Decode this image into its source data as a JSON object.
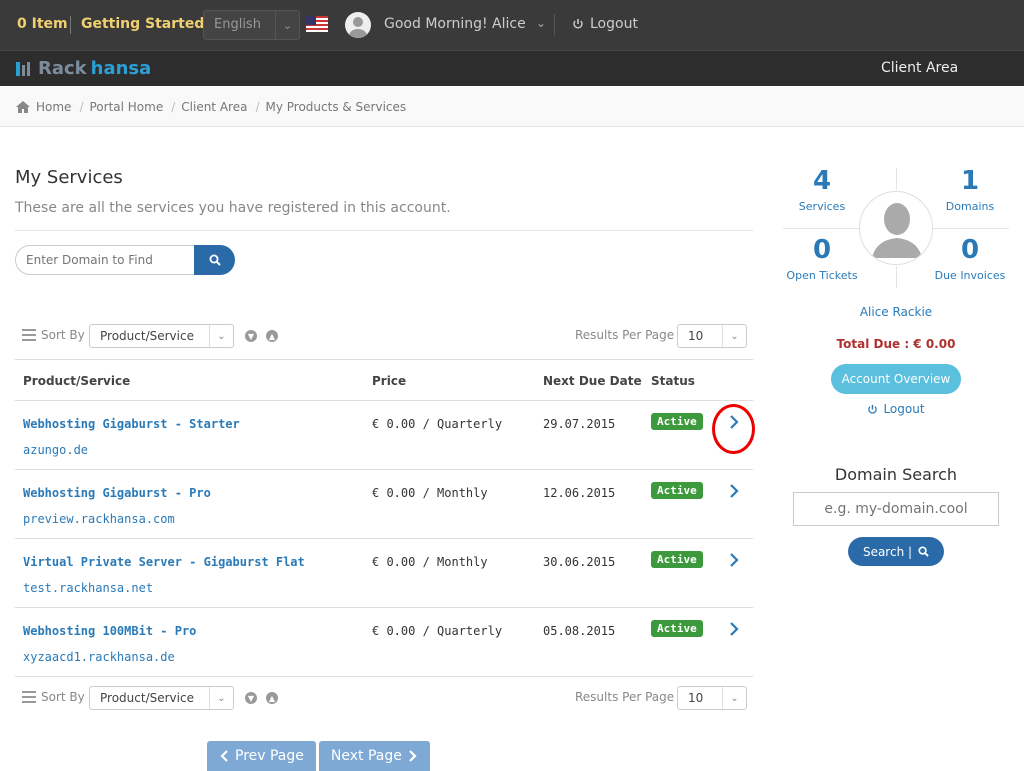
{
  "topbar": {
    "cart_items": "0 Item",
    "getting_started": "Getting Started",
    "language": "English",
    "greeting": "Good Morning! Alice",
    "logout": "Logout"
  },
  "brand": {
    "name_part1": "Rack",
    "name_part2": "hansa",
    "nav_client_area": "Client Area"
  },
  "breadcrumb": [
    "Home",
    "Portal Home",
    "Client Area",
    "My Products & Services"
  ],
  "main": {
    "title": "My Services",
    "subtitle": "These are all the services you have registered in this account.",
    "search_placeholder": "Enter Domain to Find",
    "sort_label": "Sort By",
    "sort_value": "Product/Service",
    "rpp_label": "Results Per Page",
    "rpp_value": "10",
    "columns": [
      "Product/Service",
      "Price",
      "Next Due Date",
      "Status"
    ],
    "rows": [
      {
        "name": "Webhosting Gigaburst - Starter",
        "domain": "azungo.de",
        "price": "€ 0.00 / Quarterly",
        "due": "29.07.2015",
        "status": "Active"
      },
      {
        "name": "Webhosting Gigaburst - Pro",
        "domain": "preview.rackhansa.com",
        "price": "€ 0.00 / Monthly",
        "due": "12.06.2015",
        "status": "Active"
      },
      {
        "name": "Virtual Private Server - Gigaburst Flat",
        "domain": "test.rackhansa.net",
        "price": "€ 0.00 / Monthly",
        "due": "30.06.2015",
        "status": "Active"
      },
      {
        "name": "Webhosting 100MBit - Pro",
        "domain": "xyzaacd1.rackhansa.de",
        "price": "€ 0.00 / Quarterly",
        "due": "05.08.2015",
        "status": "Active"
      }
    ],
    "prev_page": "Prev Page",
    "next_page": "Next Page"
  },
  "sidebar": {
    "services_count": "4",
    "services_label": "Services",
    "domains_count": "1",
    "domains_label": "Domains",
    "tickets_count": "0",
    "tickets_label": "Open Tickets",
    "invoices_count": "0",
    "invoices_label": "Due Invoices",
    "client_name": "Alice Rackie",
    "total_due": "Total Due : € 0.00",
    "account_overview": "Account Overview",
    "logout": "Logout",
    "domain_search_title": "Domain Search",
    "domain_search_placeholder": "e.g. my-domain.cool",
    "domain_search_button": "Search |"
  },
  "colors": {
    "accent": "#2a7ab8",
    "active_badge": "#3c9a3c",
    "topbar": "#3a3a3a",
    "brand_blue": "#2a9fd6"
  }
}
